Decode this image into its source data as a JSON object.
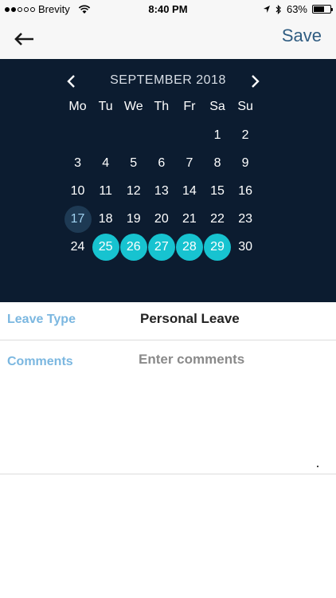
{
  "status_bar": {
    "carrier": "Brevity",
    "time": "8:40 PM",
    "battery": "63%",
    "battery_level": 0.63
  },
  "nav": {
    "save_label": "Save",
    "back_icon": "arrow-left-icon"
  },
  "calendar": {
    "month_label": "SEPTEMBER 2018",
    "weekdays": [
      "Mo",
      "Tu",
      "We",
      "Th",
      "Fr",
      "Sa",
      "Su"
    ],
    "first_weekday_index": 5,
    "days_in_month": 30,
    "today": 17,
    "selected": [
      25,
      26,
      27,
      28,
      29
    ],
    "colors": {
      "background": "#0c1c30",
      "selected": "#17c3d0",
      "today": "#1e3a54"
    }
  },
  "form": {
    "leave_type_label": "Leave Type",
    "leave_type_value": "Personal Leave",
    "comments_label": "Comments",
    "comments_placeholder": "Enter comments",
    "comments_value": ""
  }
}
